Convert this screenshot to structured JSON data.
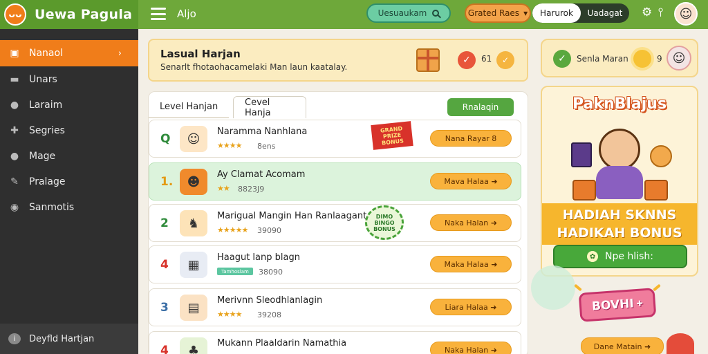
{
  "app": {
    "name": "Uewa Pagula",
    "logo_text": "ᴗᴗ"
  },
  "header": {
    "title": "Aljo",
    "search_label": "Uesuaukam",
    "grand_label": "Grated Raes",
    "grand_chevron": "▾",
    "segments": [
      {
        "label": "Harurok",
        "active": true
      },
      {
        "label": "Uadagat",
        "active": false
      }
    ],
    "icons": [
      "gear-icon",
      "pin-icon"
    ],
    "gear_glyph": "⚙",
    "pin_glyph": "⫯",
    "avatar_glyph": "☺"
  },
  "sidebar": {
    "items": [
      {
        "label": "Nanaol",
        "icon": "home-icon",
        "glyph": "▣",
        "active": true,
        "chevron": "›"
      },
      {
        "label": "Unars",
        "icon": "folder-icon",
        "glyph": "▬",
        "active": false
      },
      {
        "label": "Laraim",
        "icon": "user-icon",
        "glyph": "●",
        "active": false
      },
      {
        "label": "Segries",
        "icon": "gamepad-icon",
        "glyph": "✚",
        "active": false
      },
      {
        "label": "Mage",
        "icon": "person-icon",
        "glyph": "●",
        "active": false
      },
      {
        "label": "Pralage",
        "icon": "edit-icon",
        "glyph": "✎",
        "active": false
      },
      {
        "label": "Sanmotis",
        "icon": "settings-icon",
        "glyph": "◉",
        "active": false
      }
    ],
    "footer": {
      "label": "Deyfld Hartjan",
      "icon": "info-icon",
      "glyph": "i"
    }
  },
  "banner": {
    "title": "Lasual Harjan",
    "subtitle": "Senarlt fhotaohacamelaki Man laun kaatalay.",
    "count": "61",
    "coin_glyph": "✓",
    "check_glyph": "✓"
  },
  "panel": {
    "tabs": [
      {
        "label": "Level Hanjan"
      },
      {
        "label": "Cevel Hanja"
      }
    ],
    "apply_label": "Rnalaqin",
    "rows": [
      {
        "rank": "Q",
        "rank_color": "#2e8a3a",
        "title": "Naramma Nanhlana",
        "stars": "★★★★",
        "score": "8ens",
        "button": "Nana Rayar 8",
        "thumb_glyph": "☺",
        "thumb_bg": "#fde6c6",
        "highlight": false,
        "tag": "GRAND PRIZE BONUS"
      },
      {
        "rank": "1.",
        "rank_color": "#e39a14",
        "title": "Ay Clamat Acomam",
        "stars": "★★",
        "score": "8823J9",
        "button": "Mava Halaa ➜",
        "thumb_glyph": "☻",
        "thumb_bg": "#f08a2c",
        "highlight": true
      },
      {
        "rank": "2",
        "rank_color": "#2e8a3a",
        "title": "Marigual Mangin Han Ranlaagant",
        "stars": "★★★★★",
        "score": "39090",
        "button": "Naka Halan ➜",
        "thumb_glyph": "♞",
        "thumb_bg": "#fde3b8",
        "highlight": false,
        "seal": "DIMO BINGO BONUS"
      },
      {
        "rank": "4",
        "rank_color": "#d8322a",
        "title": "Haagut lanp blagn",
        "stars": "",
        "score": "38090",
        "button": "Maka Halaa ➜",
        "thumb_glyph": "▦",
        "thumb_bg": "#e8ecf4",
        "highlight": false,
        "greentag": "Tamhoslam"
      },
      {
        "rank": "3",
        "rank_color": "#3c6fa6",
        "title": "Merivnn Sleodhlanlagin",
        "stars": "★★★★",
        "score": "39208",
        "button": "Liara Halaa ➜",
        "thumb_glyph": "▤",
        "thumb_bg": "#fbe2c4",
        "highlight": false
      },
      {
        "rank": "4",
        "rank_color": "#d8322a",
        "title": "Mukann Plaaldarin Namathia",
        "stars": "",
        "score": "",
        "button": "Naka Halan ➜",
        "thumb_glyph": "♣",
        "thumb_bg": "#e6f3d6",
        "highlight": false
      }
    ]
  },
  "stats": {
    "label": "Senla Maran",
    "count": "9",
    "check_glyph": "✓",
    "mascot_glyph": "☺"
  },
  "promo": {
    "title": "PaknBlajus",
    "line1": "HADIAH SKNNS",
    "line2": "HADIKAH BONUS",
    "button_label": "Npe hlish:",
    "button_glyph": "✿"
  },
  "bonus_label": "BOVHI",
  "bonus_suffix": "✚",
  "bottom_button": "Dane Matain ➜",
  "colors": {
    "header_green": "#6ea83a",
    "sidebar_dark": "#2f2f2f",
    "accent_orange": "#f07d1a",
    "button_yellow": "#f9b23c",
    "cta_green": "#48a83a"
  }
}
